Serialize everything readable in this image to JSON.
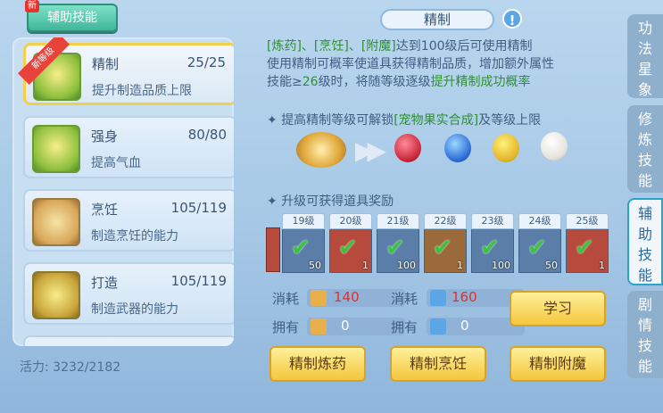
{
  "top_tab": {
    "label": "辅助技能",
    "badge": "新"
  },
  "skills": [
    {
      "name": "精制",
      "level": "25/25",
      "desc": "提升制造品质上限",
      "ribbon": "新等级",
      "icon": "golden-items-icon"
    },
    {
      "name": "强身",
      "level": "80/80",
      "desc": "提高气血",
      "icon": "muscle-man-icon"
    },
    {
      "name": "烹饪",
      "level": "105/119",
      "desc": "制造烹饪的能力",
      "icon": "drumstick-icon"
    },
    {
      "name": "打造",
      "level": "105/119",
      "desc": "制造武器的能力",
      "icon": "hammer-icon"
    }
  ],
  "vigor": {
    "label": "活力:",
    "value": "3232/2182"
  },
  "detail": {
    "title": "精制",
    "intro_tags": "[炼药]、[烹饪]、[附魔]",
    "intro_line1_rest": "达到100级后可使用精制",
    "intro_line2": "使用精制可概率使道具获得精制品质，增加额外属性",
    "intro_line3_a": "技能≥",
    "intro_line3_num": "26",
    "intro_line3_b": "级时，将随等级逐级",
    "intro_line3_hl": "提升精制成功概率",
    "unlock_a": "提高精制等级可解锁",
    "unlock_hl": "[宠物果实合成]",
    "unlock_b": "及等级上限",
    "reward_title": "升级可获得道具奖励"
  },
  "levels": [
    {
      "label": "19级",
      "count": "50"
    },
    {
      "label": "20级",
      "count": "1"
    },
    {
      "label": "21级",
      "count": "100"
    },
    {
      "label": "22级",
      "count": "1"
    },
    {
      "label": "23级",
      "count": "100"
    },
    {
      "label": "24级",
      "count": "50"
    },
    {
      "label": "25级",
      "count": "1"
    }
  ],
  "cost": {
    "consume_label": "消耗",
    "own_label": "拥有",
    "a_consume": "140",
    "a_own": "0",
    "b_consume": "160",
    "b_own": "0"
  },
  "buttons": {
    "learn": "学习",
    "refine_alchemy": "精制炼药",
    "refine_cooking": "精制烹饪",
    "refine_enchant": "精制附魔"
  },
  "side_tabs": [
    {
      "label": "功法星象"
    },
    {
      "label": "修炼技能"
    },
    {
      "label": "辅助技能"
    },
    {
      "label": "剧情技能"
    }
  ],
  "colors": {
    "accent_green": "#2f8f35",
    "consume_red": "#e0302a",
    "active_tab": "#2aa3c9"
  }
}
